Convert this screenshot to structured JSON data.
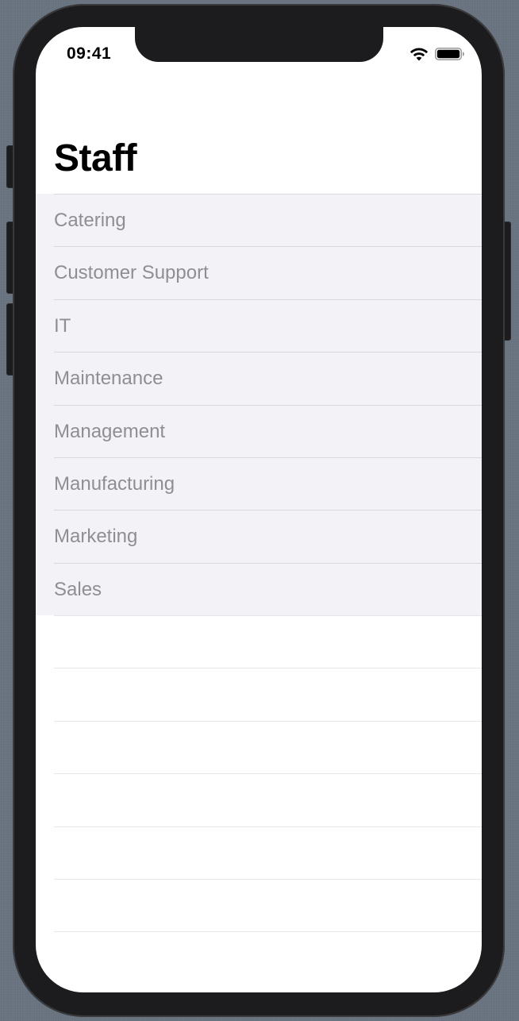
{
  "status_bar": {
    "time": "09:41"
  },
  "nav": {
    "title": "Staff"
  },
  "departments": [
    {
      "label": "Catering"
    },
    {
      "label": "Customer Support"
    },
    {
      "label": "IT"
    },
    {
      "label": "Maintenance"
    },
    {
      "label": "Management"
    },
    {
      "label": "Manufacturing"
    },
    {
      "label": "Marketing"
    },
    {
      "label": "Sales"
    }
  ],
  "icons": {
    "wifi": "wifi-icon",
    "battery": "battery-icon"
  },
  "colors": {
    "row_background": "#f2f2f7",
    "row_text": "#8e8e93",
    "title": "#000000"
  }
}
